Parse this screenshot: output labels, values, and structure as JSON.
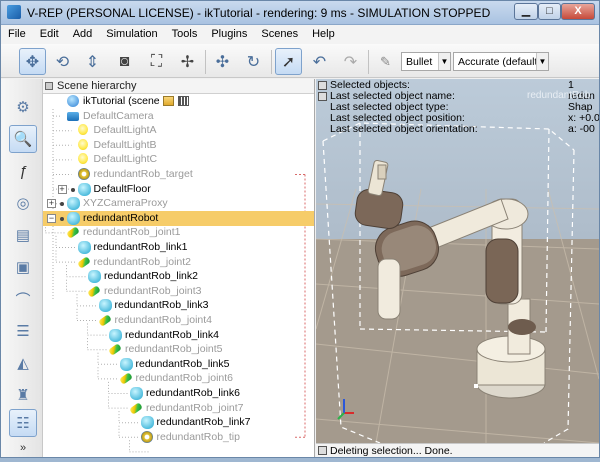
{
  "window": {
    "title": "V-REP (PERSONAL LICENSE) - ikTutorial - rendering: 9 ms - SIMULATION STOPPED",
    "minimize_label": "▁",
    "maximize_label": "□",
    "close_label": "X"
  },
  "menu": [
    "File",
    "Edit",
    "Add",
    "Simulation",
    "Tools",
    "Plugins",
    "Scenes",
    "Help"
  ],
  "toolbar": {
    "engine_select": "Bullet",
    "accuracy_select": "Accurate (default)"
  },
  "hierarchy": {
    "title": "Scene hierarchy",
    "scene_name": "ikTutorial (scene 1)",
    "items": [
      {
        "label": "DefaultCamera",
        "icon": "camera-icon",
        "disabled": true
      },
      {
        "label": "DefaultLightA",
        "icon": "light-icon",
        "disabled": true
      },
      {
        "label": "DefaultLightB",
        "icon": "light-icon",
        "disabled": true
      },
      {
        "label": "DefaultLightC",
        "icon": "light-icon",
        "disabled": true
      },
      {
        "label": "redundantRob_target",
        "icon": "dummy-icon",
        "disabled": true
      },
      {
        "label": "DefaultFloor",
        "icon": "shape-icon",
        "disabled": false
      },
      {
        "label": "XYZCameraProxy",
        "icon": "shape-icon",
        "disabled": true
      },
      {
        "label": "redundantRobot",
        "icon": "shape-icon",
        "disabled": false,
        "selected": true
      },
      {
        "label": "redundantRob_joint1",
        "icon": "joint-icon",
        "disabled": true
      },
      {
        "label": "redundantRob_link1",
        "icon": "shape-icon",
        "disabled": false
      },
      {
        "label": "redundantRob_joint2",
        "icon": "joint-icon",
        "disabled": true
      },
      {
        "label": "redundantRob_link2",
        "icon": "shape-icon",
        "disabled": false
      },
      {
        "label": "redundantRob_joint3",
        "icon": "joint-icon",
        "disabled": true
      },
      {
        "label": "redundantRob_link3",
        "icon": "shape-icon",
        "disabled": false
      },
      {
        "label": "redundantRob_joint4",
        "icon": "joint-icon",
        "disabled": true
      },
      {
        "label": "redundantRob_link4",
        "icon": "shape-icon",
        "disabled": false
      },
      {
        "label": "redundantRob_joint5",
        "icon": "joint-icon",
        "disabled": true
      },
      {
        "label": "redundantRob_link5",
        "icon": "shape-icon",
        "disabled": false
      },
      {
        "label": "redundantRob_joint6",
        "icon": "joint-icon",
        "disabled": true
      },
      {
        "label": "redundantRob_link6",
        "icon": "shape-icon",
        "disabled": false
      },
      {
        "label": "redundantRob_joint7",
        "icon": "joint-icon",
        "disabled": true
      },
      {
        "label": "redundantRob_link7",
        "icon": "shape-icon",
        "disabled": false
      },
      {
        "label": "redundantRob_tip",
        "icon": "dummy-icon",
        "disabled": true
      }
    ]
  },
  "view": {
    "info_labels": [
      "Selected objects:",
      "Last selected object name:",
      "Last selected object type:",
      "Last selected object position:",
      "Last selected object orientation:"
    ],
    "info_values": [
      "1",
      "redun",
      "Shap",
      "x: +0.0",
      "a: -00"
    ],
    "ghost_label": "redundantRob",
    "status": "Deleting selection... Done."
  },
  "colors": {
    "selection": "#f6cc69",
    "accent": "#4a6e9a"
  }
}
